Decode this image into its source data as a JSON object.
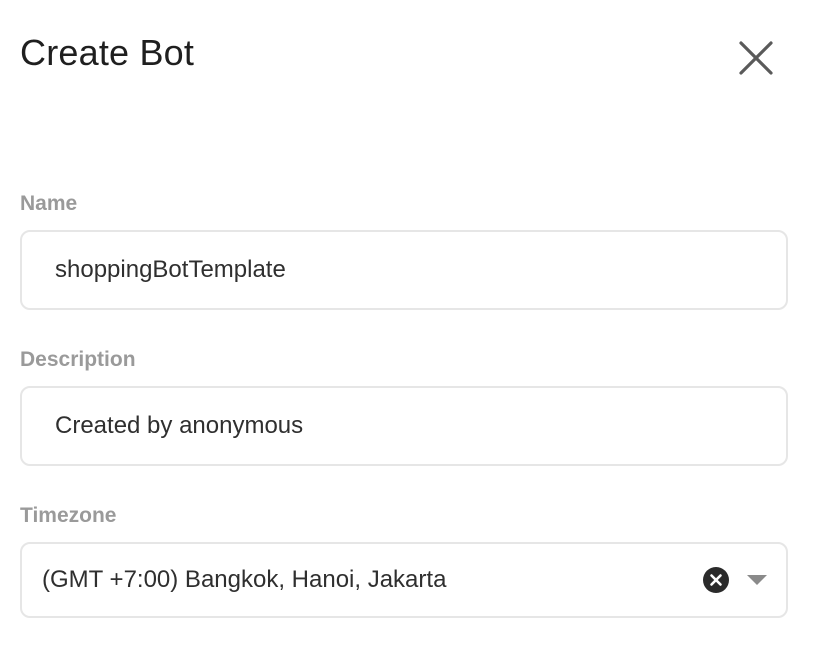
{
  "dialog": {
    "title": "Create Bot",
    "close_icon": "close-icon"
  },
  "form": {
    "name": {
      "label": "Name",
      "value": "shoppingBotTemplate"
    },
    "description": {
      "label": "Description",
      "value": "Created by anonymous"
    },
    "timezone": {
      "label": "Timezone",
      "selected": "(GMT +7:00) Bangkok, Hanoi, Jakarta",
      "clear_icon": "clear-circle-icon",
      "dropdown_icon": "caret-down-icon"
    }
  },
  "colors": {
    "label": "#9a9a9a",
    "border": "#e6e6e6",
    "text": "#2f2f2f",
    "icon": "#5a5a5a"
  }
}
